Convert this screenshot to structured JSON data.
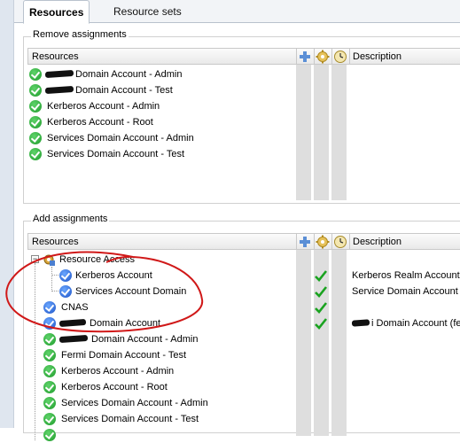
{
  "tabs": [
    {
      "label": "Resources",
      "active": true
    },
    {
      "label": "Resource sets",
      "active": false
    }
  ],
  "remove_assignments": {
    "title": "Remove assignments",
    "columns": {
      "resources": "Resources",
      "description": "Description"
    },
    "header_icons": [
      "plus-icon",
      "gear-icon",
      "clock-icon"
    ],
    "rows": [
      {
        "label": "Domain Account - Admin",
        "redacted_prefix": true
      },
      {
        "label": "Domain Account - Test",
        "redacted_prefix": true
      },
      {
        "label": "Kerberos Account - Admin"
      },
      {
        "label": "Kerberos Account - Root"
      },
      {
        "label": "Services Domain Account - Admin"
      },
      {
        "label": "Services Domain Account - Test"
      }
    ]
  },
  "add_assignments": {
    "title": "Add assignments",
    "columns": {
      "resources": "Resources",
      "description": "Description"
    },
    "header_icons": [
      "plus-icon",
      "gear-icon",
      "clock-icon"
    ],
    "tree_root": "Resource Access",
    "tree_children": [
      {
        "label": "Kerberos Account",
        "description": "Kerberos Realm Account"
      },
      {
        "label": "Services Account Domain",
        "description": "Service Domain Account ("
      }
    ],
    "rows": [
      {
        "label": "CNAS",
        "icon": "blue-check"
      },
      {
        "label": "Domain Account",
        "icon": "blue-check",
        "redacted_prefix": true,
        "description": "i Domain Account (fe"
      },
      {
        "label": "Domain Account - Admin",
        "icon": "green-check",
        "redacted_prefix": true
      },
      {
        "label": "Fermi Domain Account - Test",
        "icon": "green-check"
      },
      {
        "label": "Kerberos Account - Admin",
        "icon": "green-check"
      },
      {
        "label": "Kerberos Account - Root",
        "icon": "green-check"
      },
      {
        "label": "Services Domain Account - Admin",
        "icon": "green-check"
      },
      {
        "label": "Services Domain Account - Test",
        "icon": "green-check"
      }
    ]
  },
  "colors": {
    "accent_check_green": "#1e9b2b",
    "accent_check_blue": "#1c52c6",
    "annotation_red": "#d01818"
  }
}
